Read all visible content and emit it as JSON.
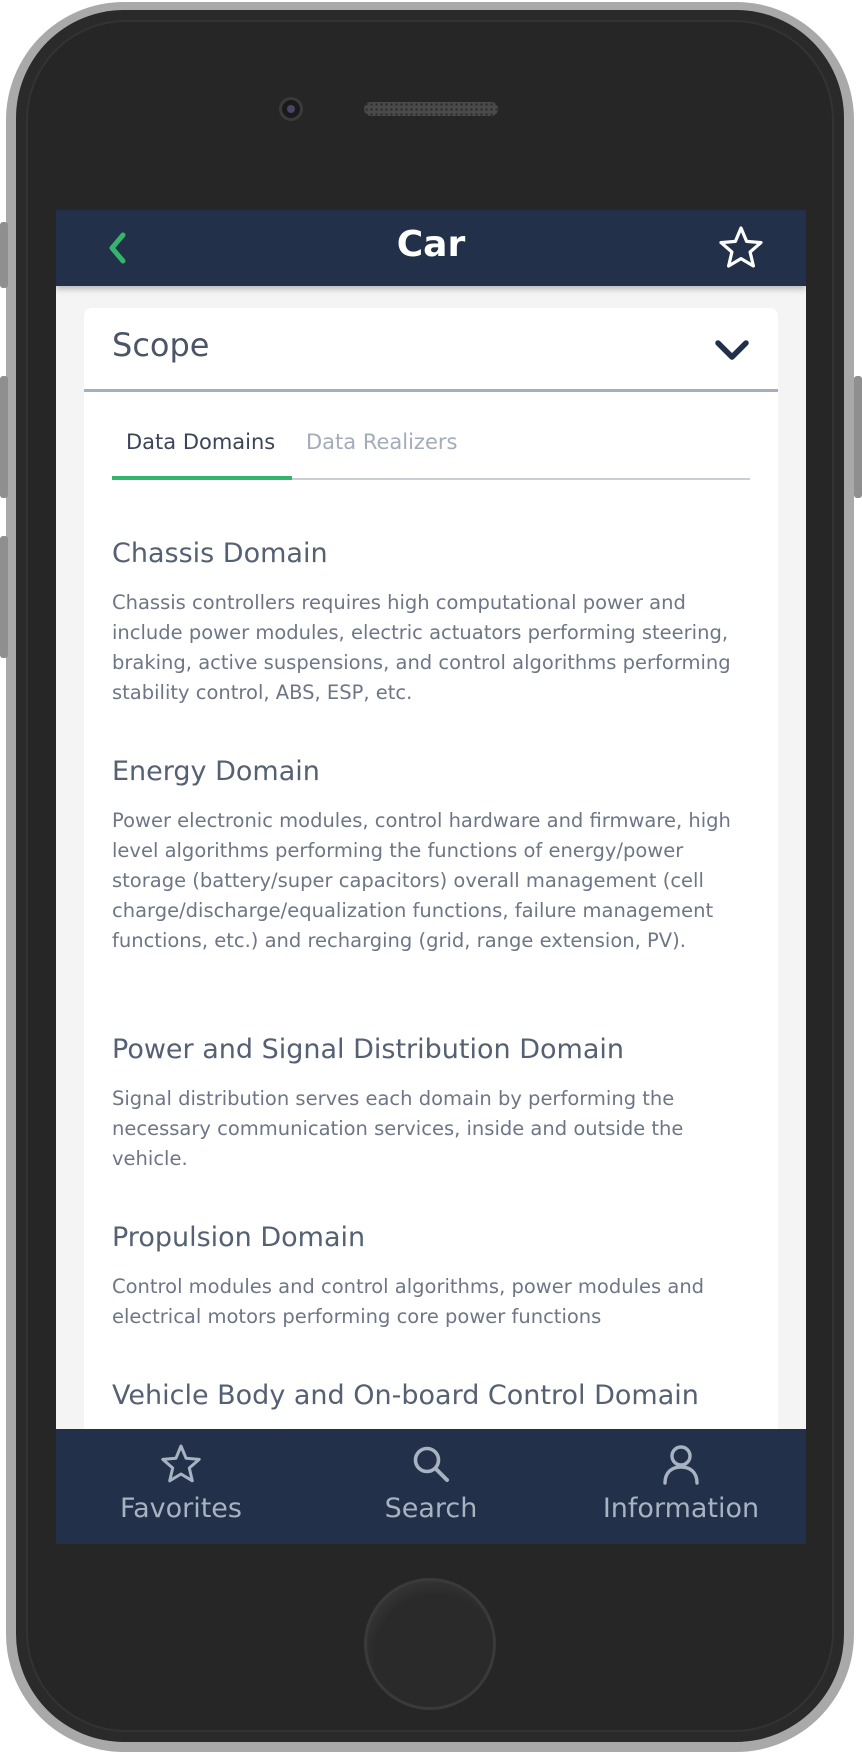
{
  "colors": {
    "header_bg": "#223149",
    "accent_green": "#35b46e",
    "tab_inactive": "#a3acb9",
    "text_title": "#556073",
    "text_body": "#6e7686"
  },
  "header": {
    "title": "Car",
    "back_icon": "chevron-left-icon",
    "favorite_icon": "star-outline-icon"
  },
  "scope": {
    "title": "Scope",
    "toggle_icon": "chevron-down-icon"
  },
  "tabs": [
    {
      "label": "Data Domains",
      "active": true
    },
    {
      "label": "Data Realizers",
      "active": false
    }
  ],
  "domains": [
    {
      "title": "Chassis Domain",
      "description": "Chassis controllers requires high computational power and include power modules, electric actuators performing steering, braking, active suspensions, and control algorithms performing stability control, ABS, ESP, etc."
    },
    {
      "title": "Energy Domain",
      "description": "Power electronic modules, control hardware and firmware, high level algorithms performing the functions of energy/power storage (battery/super capacitors) overall management (cell charge/discharge/equalization functions, failure management functions, etc.) and recharging (grid, range extension, PV)."
    },
    {
      "title": "Power and Signal Distribution Domain",
      "description": "Signal distribution serves each domain by performing the necessary communication services, inside and outside the vehicle."
    },
    {
      "title": "Propulsion Domain",
      "description": "Control modules and control algorithms, power modules and electrical motors performing core power functions"
    },
    {
      "title": "Vehicle Body and On-board Control Domain",
      "description": ""
    }
  ],
  "tab_bar": [
    {
      "label": "Favorites",
      "icon": "star-outline-icon"
    },
    {
      "label": "Search",
      "icon": "search-icon"
    },
    {
      "label": "Information",
      "icon": "user-icon"
    }
  ]
}
